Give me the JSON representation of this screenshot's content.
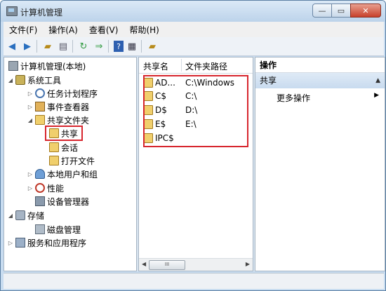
{
  "window": {
    "title": "计算机管理"
  },
  "menu": [
    "文件(F)",
    "操作(A)",
    "查看(V)",
    "帮助(H)"
  ],
  "toolbar": {
    "icons": [
      "back-icon",
      "forward-icon",
      "up-folder-icon",
      "show-hide-tree-icon",
      "refresh-icon",
      "export-list-icon",
      "help-icon",
      "properties-icon",
      "share-icon"
    ]
  },
  "tree": {
    "root": "计算机管理(本地)",
    "system_tools": "系统工具",
    "task_scheduler": "任务计划程序",
    "event_viewer": "事件查看器",
    "shared_folders": "共享文件夹",
    "shares": "共享",
    "sessions": "会话",
    "open_files": "打开文件",
    "local_users": "本地用户和组",
    "performance": "性能",
    "device_manager": "设备管理器",
    "storage": "存储",
    "disk_management": "磁盘管理",
    "services": "服务和应用程序"
  },
  "list": {
    "col_share": "共享名",
    "col_path": "文件夹路径",
    "rows": [
      {
        "name": "AD...",
        "path": "C:\\Windows"
      },
      {
        "name": "C$",
        "path": "C:\\"
      },
      {
        "name": "D$",
        "path": "D:\\"
      },
      {
        "name": "E$",
        "path": "E:\\"
      },
      {
        "name": "IPC$",
        "path": ""
      }
    ],
    "scroll_label": "III"
  },
  "actions": {
    "title": "操作",
    "section": "共享",
    "more": "更多操作"
  },
  "colors": {
    "highlight": "#d7262e",
    "accent": "#c8dcf0"
  }
}
